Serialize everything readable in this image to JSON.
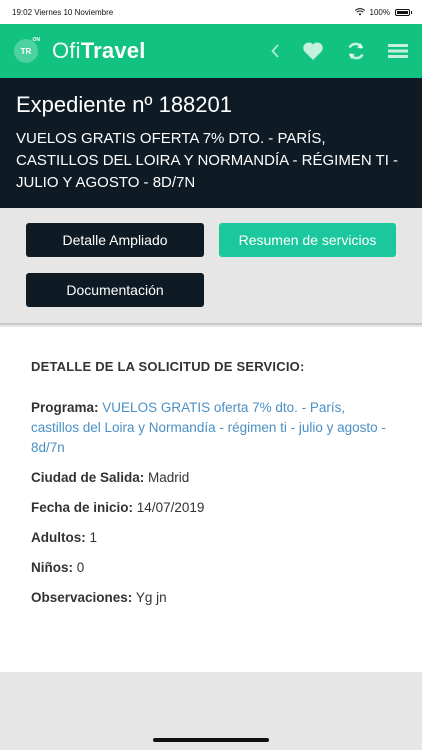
{
  "status": {
    "time": "19:02 Viernes 10 Noviembre",
    "battery": "100%"
  },
  "appbar": {
    "logo_main": "TR",
    "logo_sup": "ON",
    "brand_part1": "Ofi",
    "brand_part2": "Travel",
    "icons": [
      "chevron-left-icon",
      "heart-icon",
      "refresh-icon",
      "menu-icon"
    ]
  },
  "header": {
    "title": "Expediente nº 188201",
    "description": "VUELOS GRATIS OFERTA 7% DTO. - PARÍS, CASTILLOS DEL LOIRA Y NORMANDÍA - RÉGIMEN TI - JULIO Y AGOSTO - 8D/7N"
  },
  "buttons": {
    "detalle": "Detalle Ampliado",
    "resumen": "Resumen de servicios",
    "documentacion": "Documentación"
  },
  "detail": {
    "title": "DETALLE DE LA SOLICITUD DE SERVICIO:",
    "programa_label": "Programa:",
    "programa_value": "VUELOS GRATIS oferta 7% dto. - París, castillos del Loira y Normandía - régimen ti - julio y agosto - 8d/7n",
    "ciudad_label": "Ciudad de Salida:",
    "ciudad_value": "Madrid",
    "fecha_label": "Fecha de inicio:",
    "fecha_value": "14/07/2019",
    "adultos_label": "Adultos:",
    "adultos_value": "1",
    "ninos_label": "Niños:",
    "ninos_value": "0",
    "obs_label": "Observaciones:",
    "obs_value": "Yg jn"
  },
  "colors": {
    "accent": "#12c281",
    "dark": "#0f1b24",
    "button_green": "#1bc79c",
    "link": "#4a90c6"
  }
}
